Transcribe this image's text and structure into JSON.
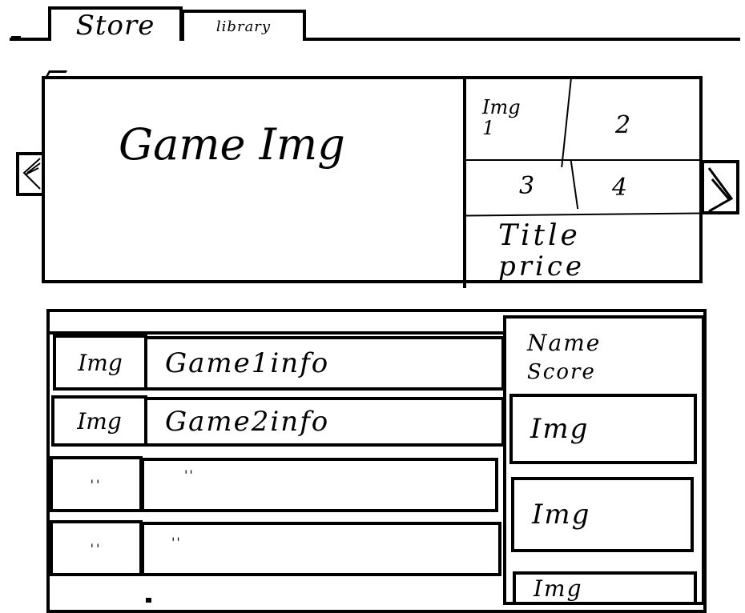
{
  "tabs": [
    {
      "label": "Store",
      "active": true
    },
    {
      "label": "library",
      "active": false
    }
  ],
  "featured": {
    "image_label": "Game Img",
    "thumbnails": [
      "Img 1",
      "2",
      "3",
      "4"
    ],
    "title": "Title",
    "price": "price",
    "prev_icon": "chevron-left-icon",
    "next_icon": "chevron-right-icon"
  },
  "game_list": {
    "rows": [
      {
        "img": "Img",
        "info": "Game1info"
      },
      {
        "img": "Img",
        "info": "Game2info"
      },
      {
        "img": "''",
        "info": "''"
      },
      {
        "img": "''",
        "info": "''"
      }
    ]
  },
  "sidebar": {
    "name": "Name",
    "score": "Score",
    "cards": [
      "Img",
      "Img",
      "Img"
    ]
  }
}
